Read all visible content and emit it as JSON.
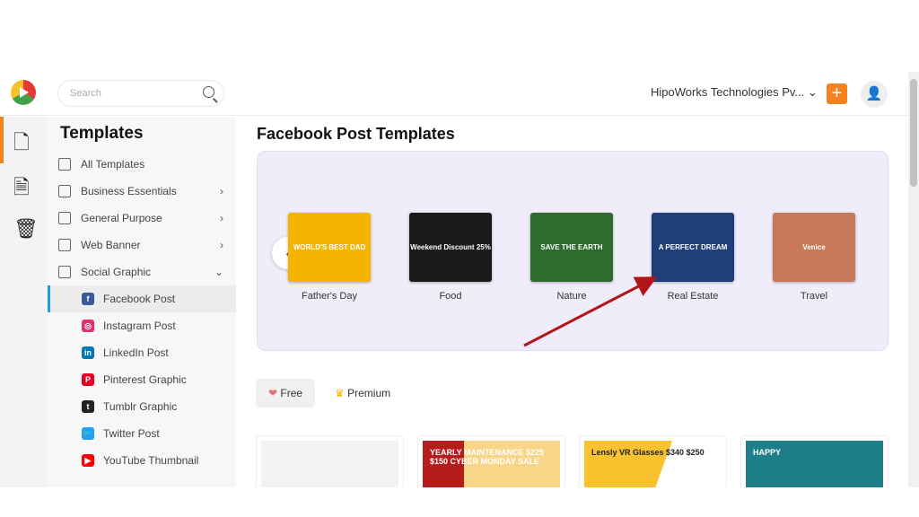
{
  "header": {
    "search_placeholder": "Search",
    "org_name": "HipoWorks Technologies Pv...",
    "add_label": "+"
  },
  "rail": {
    "icons": [
      "document-icon",
      "file-text-icon",
      "trash-icon"
    ]
  },
  "sidebar": {
    "title": "Templates",
    "items": [
      {
        "label": "All Templates"
      },
      {
        "label": "Business Essentials",
        "chevron": "›"
      },
      {
        "label": "General Purpose",
        "chevron": "›"
      },
      {
        "label": "Web Banner",
        "chevron": "›"
      },
      {
        "label": "Social Graphic",
        "chevron": "⌄"
      }
    ],
    "subitems": [
      {
        "label": "Facebook Post",
        "color": "#3b5998",
        "glyph": "f"
      },
      {
        "label": "Instagram Post",
        "color": "#e1306c",
        "glyph": "◎"
      },
      {
        "label": "LinkedIn Post",
        "color": "#0077b5",
        "glyph": "in"
      },
      {
        "label": "Pinterest Graphic",
        "color": "#e60023",
        "glyph": "P"
      },
      {
        "label": "Tumblr Graphic",
        "color": "#222222",
        "glyph": "t"
      },
      {
        "label": "Twitter Post",
        "color": "#1da1f2",
        "glyph": "🐦"
      },
      {
        "label": "YouTube Thumbnail",
        "color": "#ff0000",
        "glyph": "▶"
      }
    ]
  },
  "main": {
    "title": "Facebook Post Templates",
    "categories": [
      {
        "label": "Father's Day",
        "thumb_text": "WORLD'S BEST DAD",
        "bg": "#f4b400"
      },
      {
        "label": "Food",
        "thumb_text": "Weekend Discount 25%",
        "bg": "#1a1a1a"
      },
      {
        "label": "Nature",
        "thumb_text": "SAVE THE EARTH",
        "bg": "#2e6b2e"
      },
      {
        "label": "Real Estate",
        "thumb_text": "A PERFECT DREAM",
        "bg": "#1f3f7a"
      },
      {
        "label": "Travel",
        "thumb_text": "Venice",
        "bg": "#c9785a"
      }
    ],
    "filters": {
      "free": "Free",
      "premium": "Premium"
    },
    "cards": [
      {
        "text": ""
      },
      {
        "text": "YEARLY MAINTENANCE  $225 $150  CYBER MONDAY SALE"
      },
      {
        "text": "Lensly VR Glasses $340 $250"
      },
      {
        "text": "HAPPY"
      }
    ]
  }
}
